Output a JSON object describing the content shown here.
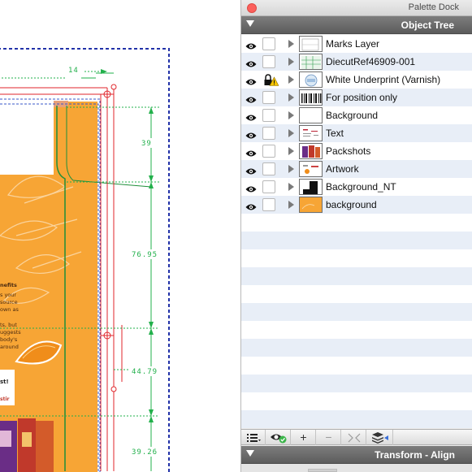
{
  "dock": {
    "title": "Palette Dock",
    "object_tree_title": "Object Tree",
    "transform_title": "Transform - Align"
  },
  "layers": [
    {
      "name": "Marks Layer",
      "visible": true,
      "locked": false,
      "warning": false,
      "thumb": "marks"
    },
    {
      "name": "DiecutRef46909-001",
      "visible": true,
      "locked": false,
      "warning": false,
      "thumb": "diecut"
    },
    {
      "name": "White Underprint (Varnish)",
      "visible": true,
      "locked": true,
      "warning": true,
      "thumb": "underprint"
    },
    {
      "name": "For position only",
      "visible": true,
      "locked": false,
      "warning": false,
      "thumb": "barcode"
    },
    {
      "name": "Background",
      "visible": true,
      "locked": false,
      "warning": false,
      "thumb": "blank"
    },
    {
      "name": "Text",
      "visible": true,
      "locked": false,
      "warning": false,
      "thumb": "text"
    },
    {
      "name": "Packshots",
      "visible": true,
      "locked": false,
      "warning": false,
      "thumb": "packshots"
    },
    {
      "name": "Artwork",
      "visible": true,
      "locked": false,
      "warning": false,
      "thumb": "artwork"
    },
    {
      "name": "Background_NT",
      "visible": true,
      "locked": false,
      "warning": false,
      "thumb": "bgnt"
    },
    {
      "name": "background",
      "visible": true,
      "locked": false,
      "warning": false,
      "thumb": "orange"
    }
  ],
  "toolbar": {
    "list_icon": "list-menu-icon",
    "visibility_icon": "eye-check-icon",
    "add_label": "+",
    "remove_label": "−",
    "collapse_icon": "collapse-arrows-icon",
    "layers_icon": "layers-icon"
  },
  "canvas": {
    "dimensions": [
      "14",
      "39",
      "76.95",
      "44.79",
      "39.26"
    ],
    "copy_fragments": [
      "nefits",
      "s your",
      "source",
      "own as",
      "ts, but",
      "uggests",
      "body's",
      "around",
      "st!",
      "stir"
    ],
    "colors": {
      "orange": "#f7a535",
      "dimension_green": "#22b04b",
      "guide_red": "#e0262b",
      "bleed_blue": "#2232a8"
    }
  }
}
